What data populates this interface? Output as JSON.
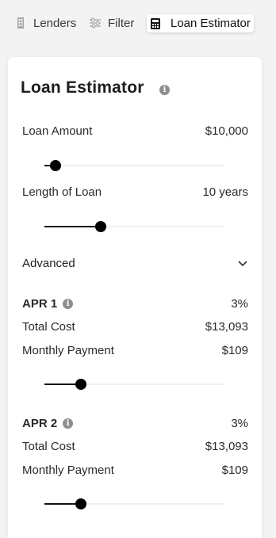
{
  "tabs": [
    {
      "label": "Lenders",
      "icon": "building-icon"
    },
    {
      "label": "Filter",
      "icon": "sliders-icon"
    },
    {
      "label": "Loan Estimator",
      "icon": "calculator-icon",
      "active": true
    }
  ],
  "card": {
    "title": "Loan Estimator",
    "loan_amount": {
      "label": "Loan Amount",
      "value": "$10,000",
      "slider_fraction": 0.06
    },
    "loan_length": {
      "label": "Length of Loan",
      "value": "10 years",
      "slider_fraction": 0.31
    },
    "advanced_label": "Advanced",
    "apr1": {
      "label": "APR 1",
      "rate": "3%",
      "total_cost_label": "Total Cost",
      "total_cost": "$13,093",
      "monthly_label": "Monthly Payment",
      "monthly": "$109",
      "slider_fraction": 0.2
    },
    "apr2": {
      "label": "APR 2",
      "rate": "3%",
      "total_cost_label": "Total Cost",
      "total_cost": "$13,093",
      "monthly_label": "Monthly Payment",
      "monthly": "$109",
      "slider_fraction": 0.2
    }
  },
  "colors": {
    "accent": "#000000",
    "track": "#f0f0f0",
    "icon_gray": "#8e8e8e"
  }
}
